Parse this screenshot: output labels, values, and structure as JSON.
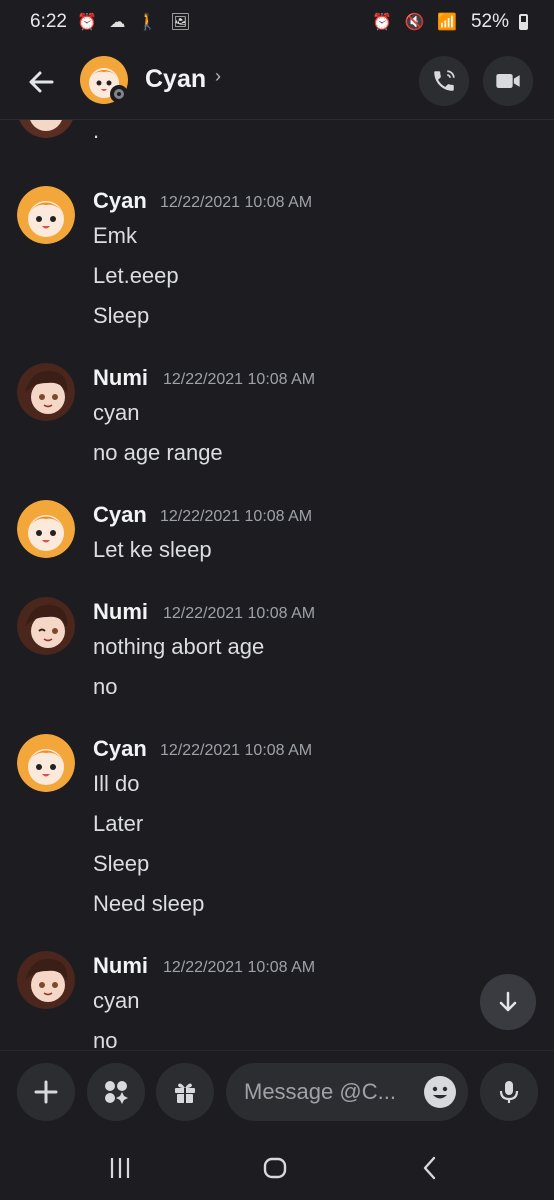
{
  "status_bar": {
    "time": "6:22",
    "left_icons": "⏰ ☁ 🚶 🖼",
    "right_icons": "⏰ 🔇 📶",
    "battery": "52%"
  },
  "header": {
    "name": "Cyan",
    "chevron": "›"
  },
  "messages": {
    "partial_text": ".",
    "groups": [
      {
        "author": "Cyan",
        "time": "12/22/2021 10:08 AM",
        "lines": [
          "Emk",
          "Let.eeep",
          "Sleep"
        ]
      },
      {
        "author": "Numi",
        "time": "12/22/2021 10:08 AM",
        "lines": [
          "cyan",
          "no age range"
        ]
      },
      {
        "author": "Cyan",
        "time": "12/22/2021 10:08 AM",
        "lines": [
          "Let ke sleep"
        ]
      },
      {
        "author": "Numi",
        "time": "12/22/2021 10:08 AM",
        "lines": [
          "nothing abort age",
          "no"
        ]
      },
      {
        "author": "Cyan",
        "time": "12/22/2021 10:08 AM",
        "lines": [
          "Ill do",
          "Later",
          "Sleep",
          "Need sleep"
        ]
      },
      {
        "author": "Numi",
        "time": "12/22/2021 10:08 AM",
        "lines": [
          "cyan",
          "no"
        ]
      }
    ]
  },
  "composer": {
    "placeholder": "Message @C..."
  },
  "colors": {
    "background": "#1d1d21",
    "button_bg": "#2b2d31",
    "timestamp": "#9ea1a8"
  }
}
